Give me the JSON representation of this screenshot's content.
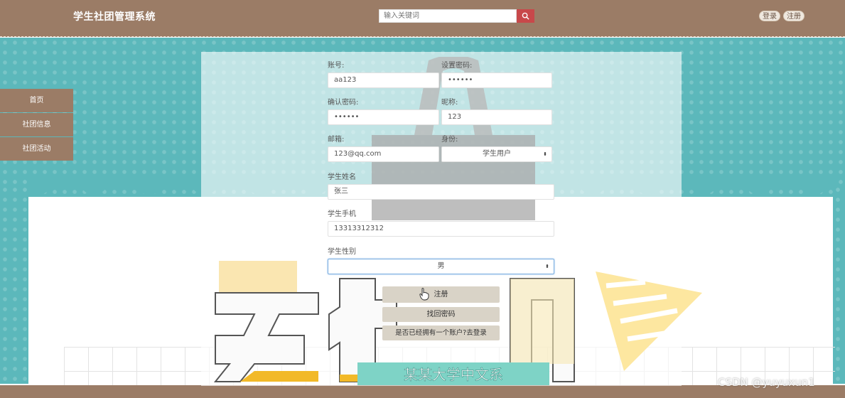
{
  "header": {
    "title": "学生社团管理系统",
    "search_placeholder": "输入关键词",
    "login_label": "登录",
    "register_label": "注册"
  },
  "sidebar": {
    "items": [
      {
        "label": "首页"
      },
      {
        "label": "社团信息"
      },
      {
        "label": "社团活动"
      }
    ]
  },
  "form": {
    "account_label": "账号:",
    "account_value": "aa123",
    "password_label": "设置密码:",
    "password_value": "••••••",
    "confirm_label": "确认密码:",
    "confirm_value": "••••••",
    "nickname_label": "昵称:",
    "nickname_value": "123",
    "email_label": "邮箱:",
    "email_value": "123@qq.com",
    "identity_label": "身份:",
    "identity_value": "学生用户",
    "name_label": "学生姓名",
    "name_value": "张三",
    "phone_label": "学生手机",
    "phone_value": "13313312312",
    "gender_label": "学生性别",
    "gender_value": "男"
  },
  "buttons": {
    "register": "注册",
    "recover": "找回密码",
    "to_login": "是否已经拥有一个账户?去登录"
  },
  "decoration": {
    "banner_text": "某某大学中文系"
  },
  "watermark": "CSDN @yuyuxun1",
  "colors": {
    "header_brown": "#9b7c66",
    "teal": "#5cb8bb",
    "search_button_red": "#c8484a",
    "button_beige": "#d9d3c7"
  }
}
